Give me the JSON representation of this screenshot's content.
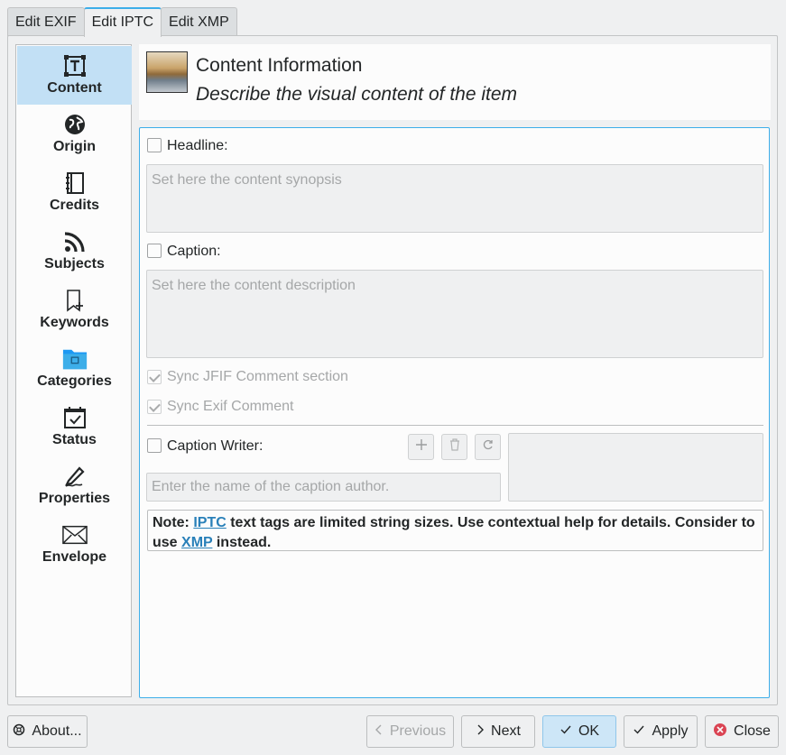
{
  "tabs": [
    {
      "label": "Edit EXIF"
    },
    {
      "label": "Edit IPTC"
    },
    {
      "label": "Edit XMP"
    }
  ],
  "sidebar": {
    "items": [
      {
        "label": "Content",
        "icon": "text-frame-icon"
      },
      {
        "label": "Origin",
        "icon": "globe-icon"
      },
      {
        "label": "Credits",
        "icon": "notebook-icon"
      },
      {
        "label": "Subjects",
        "icon": "rss-icon"
      },
      {
        "label": "Keywords",
        "icon": "bookmark-add-icon"
      },
      {
        "label": "Categories",
        "icon": "folder-image-icon"
      },
      {
        "label": "Status",
        "icon": "calendar-check-icon"
      },
      {
        "label": "Properties",
        "icon": "pen-icon"
      },
      {
        "label": "Envelope",
        "icon": "envelope-icon"
      }
    ]
  },
  "header": {
    "title": "Content Information",
    "subtitle": "Describe the visual content of the item"
  },
  "form": {
    "headline_label": "Headline:",
    "headline_placeholder": "Set here the content synopsis",
    "caption_label": "Caption:",
    "caption_placeholder": "Set here the content description",
    "sync_jfif_label": "Sync JFIF Comment section",
    "sync_exif_label": "Sync Exif Comment",
    "caption_writer_label": "Caption Writer:",
    "caption_writer_placeholder": "Enter the name of the caption author."
  },
  "note": {
    "prefix": "Note: ",
    "iptc_link": "IPTC",
    "middle": " text tags are limited string sizes. Use contextual help for details. Consider to use ",
    "xmp_link": "XMP",
    "suffix": " instead."
  },
  "buttons": {
    "about": "About...",
    "previous": "Previous",
    "next": "Next",
    "ok": "OK",
    "apply": "Apply",
    "close": "Close"
  },
  "colors": {
    "accent": "#3daee9",
    "selection": "#c2e0f5",
    "link": "#2980b9",
    "close_red": "#da4453"
  }
}
